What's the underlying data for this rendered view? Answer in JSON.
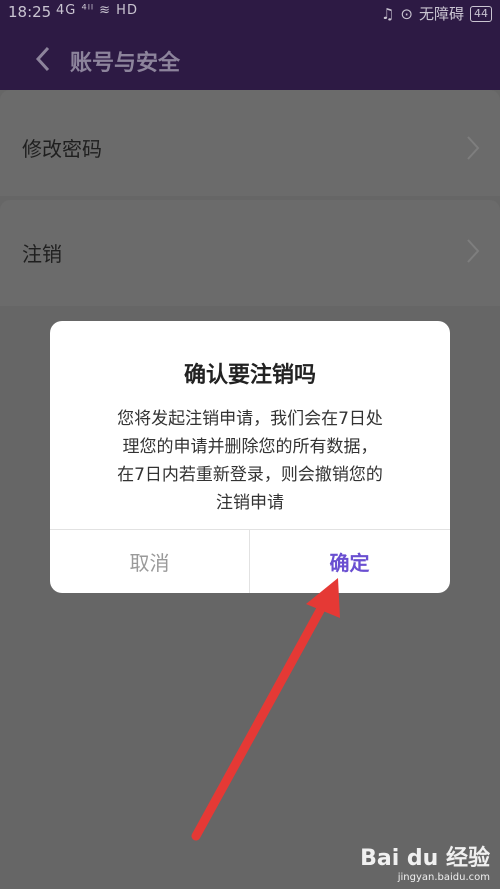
{
  "status_bar": {
    "time": "18:25",
    "signal": "4G ⁴ˡˡ ≋ HD",
    "network": "无障碍",
    "battery": "44"
  },
  "header": {
    "title": "账号与安全"
  },
  "settings": {
    "items": [
      {
        "label": "修改密码"
      },
      {
        "label": "注销"
      }
    ]
  },
  "dialog": {
    "title": "确认要注销吗",
    "message_lines": [
      "您将发起注销申请，我们会在7日处",
      "理您的申请并删除您的所有数据，",
      "在7日内若重新登录，则会撤销您的",
      "注销申请"
    ],
    "cancel_label": "取消",
    "confirm_label": "确定"
  },
  "colors": {
    "accent": "#6a4fd1",
    "arrow": "#e53935",
    "header_bg": "#2d1a44",
    "overlay": "#666666"
  },
  "watermark": {
    "brand": "Bai du 经验",
    "url": "jingyan.baidu.com"
  }
}
